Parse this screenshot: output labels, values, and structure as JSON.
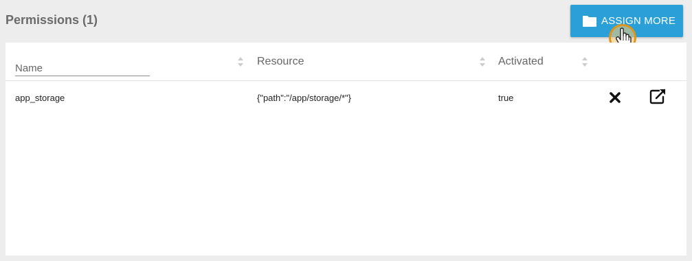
{
  "header": {
    "title": "Permissions (1)"
  },
  "assign_button": {
    "label": "ASSIGN MORE",
    "icon": "folder-icon",
    "color": "#2ba0d8"
  },
  "table": {
    "columns": [
      {
        "label": "Name",
        "sortable": true
      },
      {
        "label": "Resource",
        "sortable": true
      },
      {
        "label": "Activated",
        "sortable": true
      }
    ],
    "rows": [
      {
        "name": "app_storage",
        "resource": "{\"path\":\"/app/storage/*\"}",
        "activated": "true",
        "actions": [
          "delete-icon",
          "open-external-icon"
        ]
      }
    ]
  }
}
